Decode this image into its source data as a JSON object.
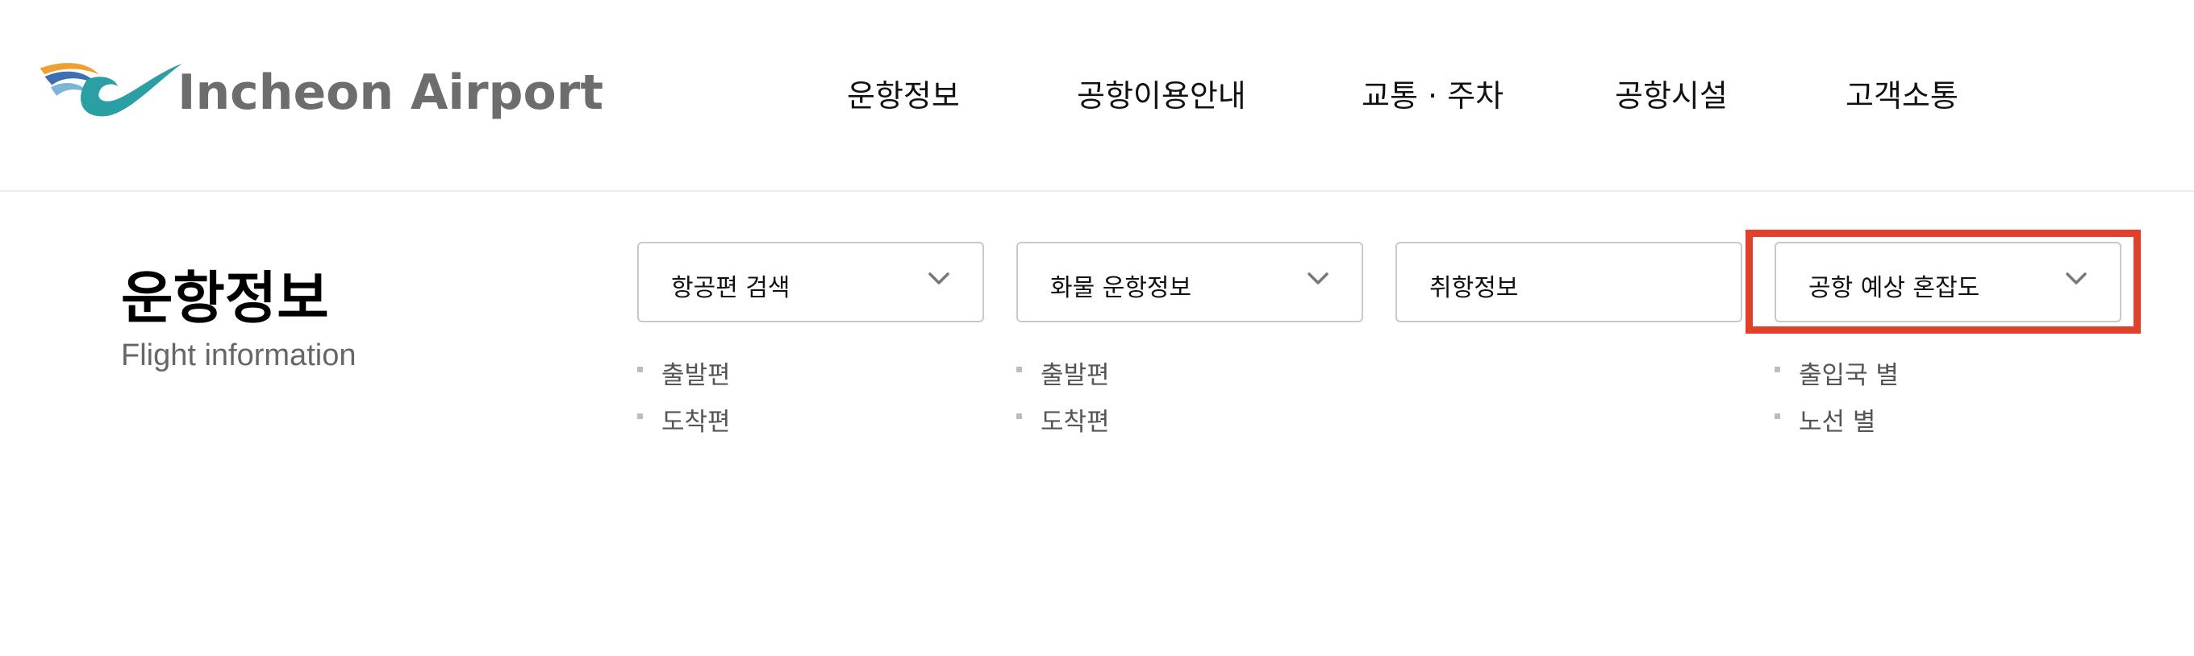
{
  "logo": {
    "text": "Incheon Airport",
    "colors": {
      "orange": "#f0a030",
      "blue": "#3e6fb5",
      "teal": "#2aa0a4",
      "text": "#6d6d6d"
    }
  },
  "nav": {
    "items": [
      {
        "label": "운항정보"
      },
      {
        "label": "공항이용안내"
      },
      {
        "label": "교통 · 주차"
      },
      {
        "label": "공항시설"
      },
      {
        "label": "고객소통"
      }
    ]
  },
  "page": {
    "title": "운항정보",
    "subtitle": "Flight information"
  },
  "menu": [
    {
      "label": "항공편 검색",
      "icon": "chevron-down-icon",
      "sub": [
        "출발편",
        "도착편"
      ]
    },
    {
      "label": "화물 운항정보",
      "icon": "chevron-down-icon",
      "sub": [
        "출발편",
        "도착편"
      ]
    },
    {
      "label": "취항정보",
      "sub": []
    },
    {
      "label": "공항 예상 혼잡도",
      "icon": "chevron-down-icon",
      "sub": [
        "출입국 별",
        "노선 별"
      ]
    }
  ],
  "highlight": {
    "color": "#e0412c"
  }
}
